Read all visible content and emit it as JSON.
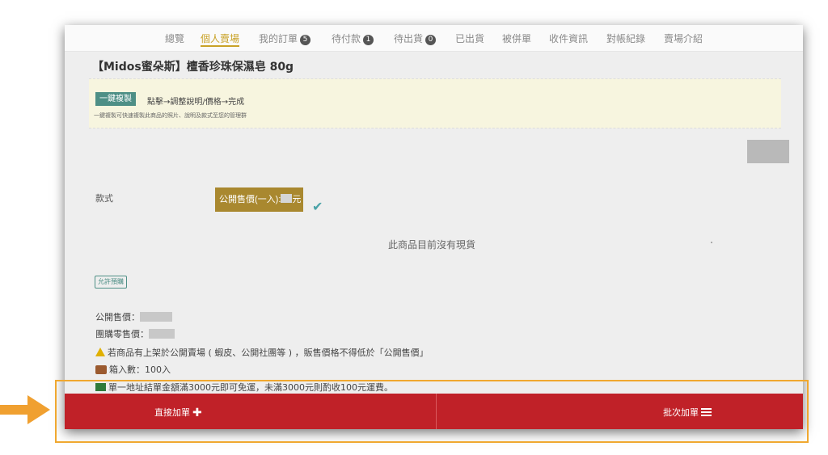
{
  "nav": {
    "tabs": [
      {
        "label": "總覽"
      },
      {
        "label": "個人賣場"
      },
      {
        "label": "我的訂單",
        "badge": "5"
      },
      {
        "label": "待付款",
        "badge": "1"
      },
      {
        "label": "待出貨",
        "badge": "0"
      },
      {
        "label": "已出貨"
      },
      {
        "label": "被併單"
      },
      {
        "label": "收件資訊"
      },
      {
        "label": "對帳紀錄"
      },
      {
        "label": "賣場介紹"
      }
    ]
  },
  "product": {
    "title": "【Midos蜜朵斯】檀香珍珠保濕皂 80g"
  },
  "notice": {
    "copy_button": "一鍵複製",
    "instruction": "點擊→調整說明/價格→完成",
    "small_text": "一鍵複製可快速複製此商品的照片、說明及款式至您的管理群"
  },
  "options": {
    "style_label": "款式",
    "price_option": "公開售價(一入):",
    "price_option_suffix": "元"
  },
  "stock": {
    "no_stock": "此商品目前沒有現貨"
  },
  "preorder_tag": "允許預購",
  "info": {
    "public_price": "公開售價：",
    "group_price": "團購零售價：",
    "warning": "若商品有上架於公開賣場 ( 蝦皮、公開社團等 ) ，販售價格不得低於「公開售價」",
    "box_qty": "箱入數：100入",
    "shipping": "單一地址結單金額滿3000元即可免運，未滿3000元則酌收100元運費。"
  },
  "actions": {
    "add_direct": "直接加單",
    "add_batch": "批次加單"
  },
  "colors": {
    "accent_gold": "#c9a227",
    "action_red": "#c02128",
    "annotation_orange": "#f0a830",
    "teal": "#4e8f86"
  }
}
